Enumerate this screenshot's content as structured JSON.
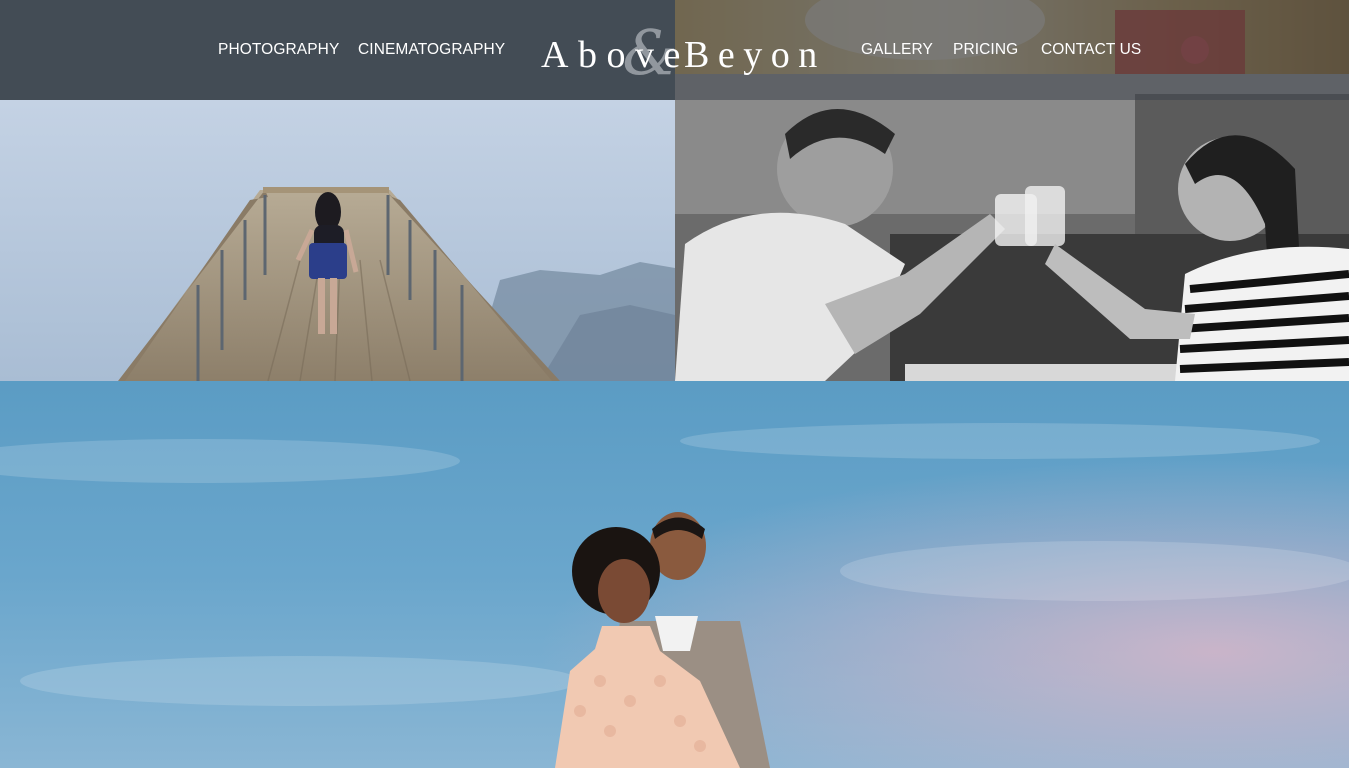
{
  "nav": {
    "left": [
      {
        "label": "PHOTOGRAPHY"
      },
      {
        "label": "CINEMATOGRAPHY"
      }
    ],
    "right": [
      {
        "label": "GALLERY"
      },
      {
        "label": "PRICING"
      },
      {
        "label": "CONTACT US"
      }
    ]
  },
  "logo": {
    "word1": "Above",
    "ampersand": "&",
    "word2": "Beyond"
  },
  "icons": {
    "logo": "above-beyond-logo"
  },
  "colors": {
    "header_overlay": "#444c56",
    "nav_text": "#ffffff",
    "sky_blue": "#5a9ac2",
    "pier_sky": "#b8cce0",
    "logo_amp": "#9aa0a6"
  }
}
